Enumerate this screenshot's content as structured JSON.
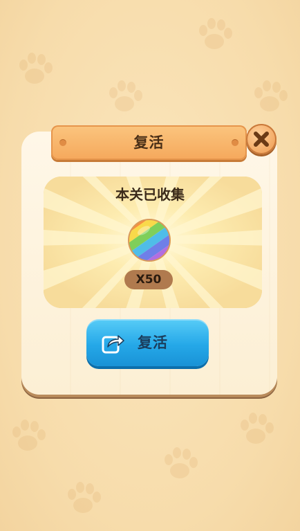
{
  "dialog": {
    "title": "复活",
    "close_icon": "close-icon"
  },
  "reward": {
    "title": "本关已收集",
    "item_icon": "rainbow-candy-icon",
    "count_text": "X50"
  },
  "revive_button": {
    "label": "复活",
    "icon": "share-icon"
  },
  "colors": {
    "background": "#f8e2b4",
    "banner": "#f5a85c",
    "button": "#25a8e8",
    "text_dark": "#4a2f17"
  }
}
